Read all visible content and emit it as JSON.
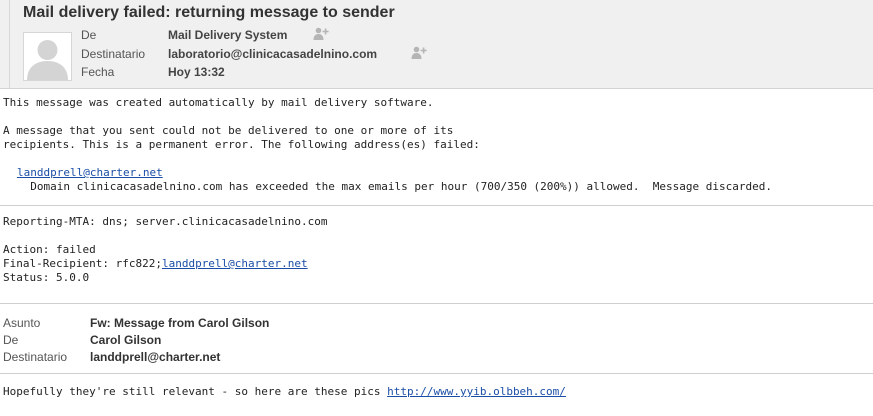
{
  "message": {
    "subject": "Mail delivery failed: returning message to sender",
    "headers": {
      "from_label": "De",
      "from_value": "Mail Delivery System",
      "to_label": "Destinatario",
      "to_value": "laboratorio@clinicacasadelnino.com",
      "date_label": "Fecha",
      "date_value": "Hoy 13:32"
    }
  },
  "body": {
    "line1": "This message was created automatically by mail delivery software.",
    "line2": "A message that you sent could not be delivered to one or more of its",
    "line3": "recipients. This is a permanent error. The following address(es) failed:",
    "failed_address": "landdprell@charter.net",
    "domain_error": "  Domain clinicacasadelnino.com has exceeded the max emails per hour (700/350 (200%)) allowed.  Message discarded.",
    "reporting_mta": "Reporting-MTA: dns; server.clinicacasadelnino.com",
    "action": "Action: failed",
    "final_recipient_prefix": "Final-Recipient: rfc822;",
    "final_recipient_address": "landdprell@charter.net",
    "status": "Status: 5.0.0"
  },
  "forwarded": {
    "subject_label": "Asunto",
    "subject_value": "Fw: Message from Carol Gilson",
    "from_label": "De",
    "from_value": "Carol Gilson",
    "to_label": "Destinatario",
    "to_value": "landdprell@charter.net",
    "text_prefix": "Hopefully they're still relevant - so here are these pics ",
    "link": "http://www.yyib.olbbeh.com/"
  },
  "icons": {
    "avatar": "user-avatar-icon",
    "add_contact": "add-contact-icon"
  }
}
